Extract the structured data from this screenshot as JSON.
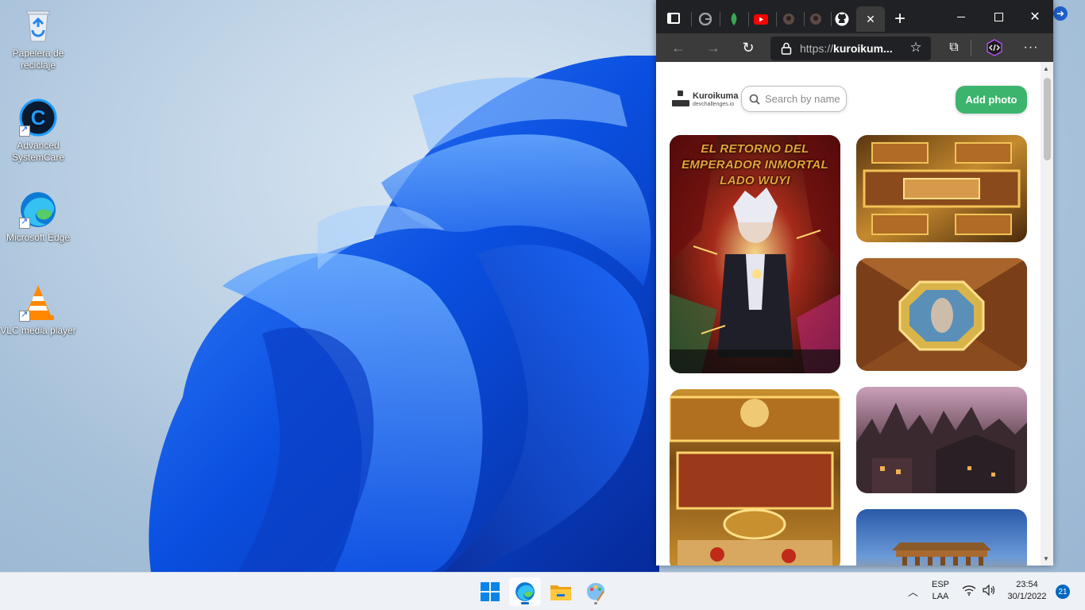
{
  "desktop": {
    "icons": [
      {
        "label": "Papelera de reciclaje"
      },
      {
        "label": "Advanced SystemCare"
      },
      {
        "label": "Microsoft Edge"
      },
      {
        "label": "VLC media player"
      }
    ]
  },
  "browser": {
    "tabs": [
      {
        "icon": "google-icon"
      },
      {
        "icon": "leaf-icon"
      },
      {
        "icon": "youtube-icon"
      },
      {
        "icon": "avatar-icon"
      },
      {
        "icon": "avatar-icon"
      },
      {
        "icon": "github-icon"
      }
    ],
    "url_protocol": "https://",
    "url_host": "kuroikum...",
    "new_tab_label": "+",
    "close_tab_label": "✕"
  },
  "page": {
    "logo_title": "Kuroikuma",
    "logo_subtitle": "devchallenges.io",
    "search_placeholder": "Search by name",
    "add_button": "Add photo",
    "photos": [
      {
        "title": "EL RETORNO DEL EMPERADOR INMORTAL LADO WUYI"
      },
      {
        "title": ""
      },
      {
        "title": ""
      },
      {
        "title": ""
      },
      {
        "title": ""
      },
      {
        "title": ""
      }
    ]
  },
  "taskbar": {
    "language_line1": "ESP",
    "language_line2": "LAA",
    "time": "23:54",
    "date": "30/1/2022",
    "notification_count": "21"
  },
  "colors": {
    "accent_green": "#3db46d",
    "taskbar_accent": "#0067c0"
  }
}
